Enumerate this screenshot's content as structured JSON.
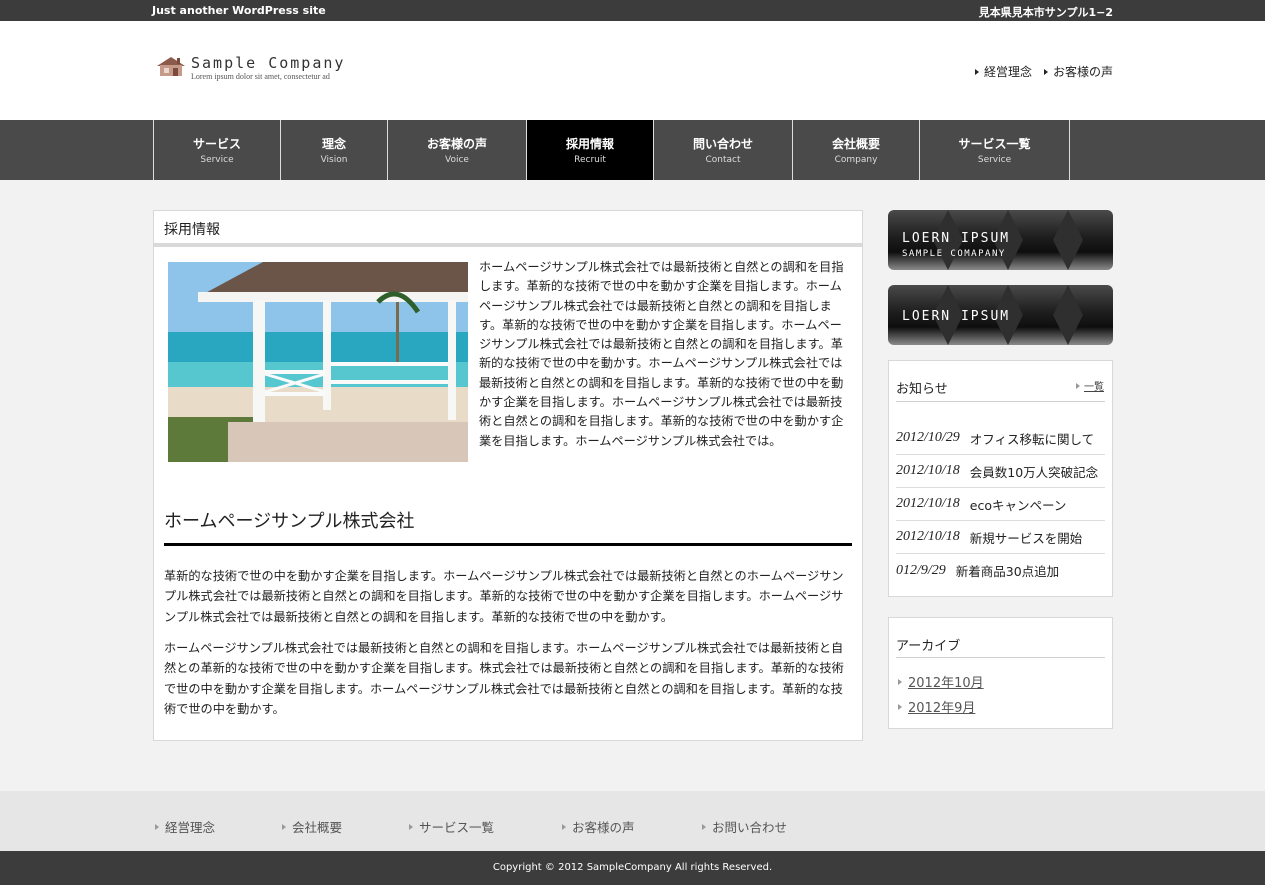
{
  "topbar": {
    "tagline": "Just another WordPress site",
    "address": "見本県見本市サンプル1−2"
  },
  "logo": {
    "name": "Sample Company",
    "sub": "Lorem ipsum dolor sit amet, consectetur ad"
  },
  "header_links": [
    "経営理念",
    "お客様の声"
  ],
  "nav": [
    {
      "jp": "サービス",
      "en": "Service"
    },
    {
      "jp": "理念",
      "en": "Vision"
    },
    {
      "jp": "お客様の声",
      "en": "Voice"
    },
    {
      "jp": "採用情報",
      "en": "Recruit",
      "active": true
    },
    {
      "jp": "問い合わせ",
      "en": "Contact"
    },
    {
      "jp": "会社概要",
      "en": "Company"
    },
    {
      "jp": "サービス一覧",
      "en": "Service"
    }
  ],
  "main": {
    "title": "採用情報",
    "intro": "ホームページサンプル株式会社では最新技術と自然との調和を目指します。革新的な技術で世の中を動かす企業を目指します。ホームページサンプル株式会社では最新技術と自然との調和を目指します。革新的な技術で世の中を動かす企業を目指します。ホームページサンプル株式会社では最新技術と自然との調和を目指します。革新的な技術で世の中を動かす。ホームページサンプル株式会社では最新技術と自然との調和を目指します。革新的な技術で世の中を動かす企業を目指します。ホームページサンプル株式会社では最新技術と自然との調和を目指します。革新的な技術で世の中を動かす企業を目指します。ホームページサンプル株式会社では。",
    "section_title": "ホームページサンプル株式会社",
    "para1": "革新的な技術で世の中を動かす企業を目指します。ホームページサンプル株式会社では最新技術と自然とのホームページサンプル株式会社では最新技術と自然との調和を目指します。革新的な技術で世の中を動かす企業を目指します。ホームページサンプル株式会社では最新技術と自然との調和を目指します。革新的な技術で世の中を動かす。",
    "para2": "ホームページサンプル株式会社では最新技術と自然との調和を目指します。ホームページサンプル株式会社では最新技術と自然との革新的な技術で世の中を動かす企業を目指します。株式会社では最新技術と自然との調和を目指します。革新的な技術で世の中を動かす企業を目指します。ホームページサンプル株式会社では最新技術と自然との調和を目指します。革新的な技術で世の中を動かす。"
  },
  "banners": [
    {
      "line1": "LOERN IPSUM",
      "line2": "SAMPLE COMAPANY"
    },
    {
      "line1": "LOERN IPSUM"
    }
  ],
  "news": {
    "heading": "お知らせ",
    "more": "一覧",
    "items": [
      {
        "date": "2012/10/29",
        "text": "オフィス移転に関して"
      },
      {
        "date": "2012/10/18",
        "text": "会員数10万人突破記念"
      },
      {
        "date": "2012/10/18",
        "text": "ecoキャンペーン"
      },
      {
        "date": "2012/10/18",
        "text": "新規サービスを開始"
      },
      {
        "date": "012/9/29",
        "text": "新着商品30点追加"
      }
    ]
  },
  "archive": {
    "heading": "アーカイブ",
    "items": [
      "2012年10月",
      "2012年9月"
    ]
  },
  "footer_links": [
    "経営理念",
    "会社概要",
    "サービス一覧",
    "お客様の声",
    "お問い合わせ"
  ],
  "copyright": "Copyright © 2012 SampleCompany All rights Reserved."
}
